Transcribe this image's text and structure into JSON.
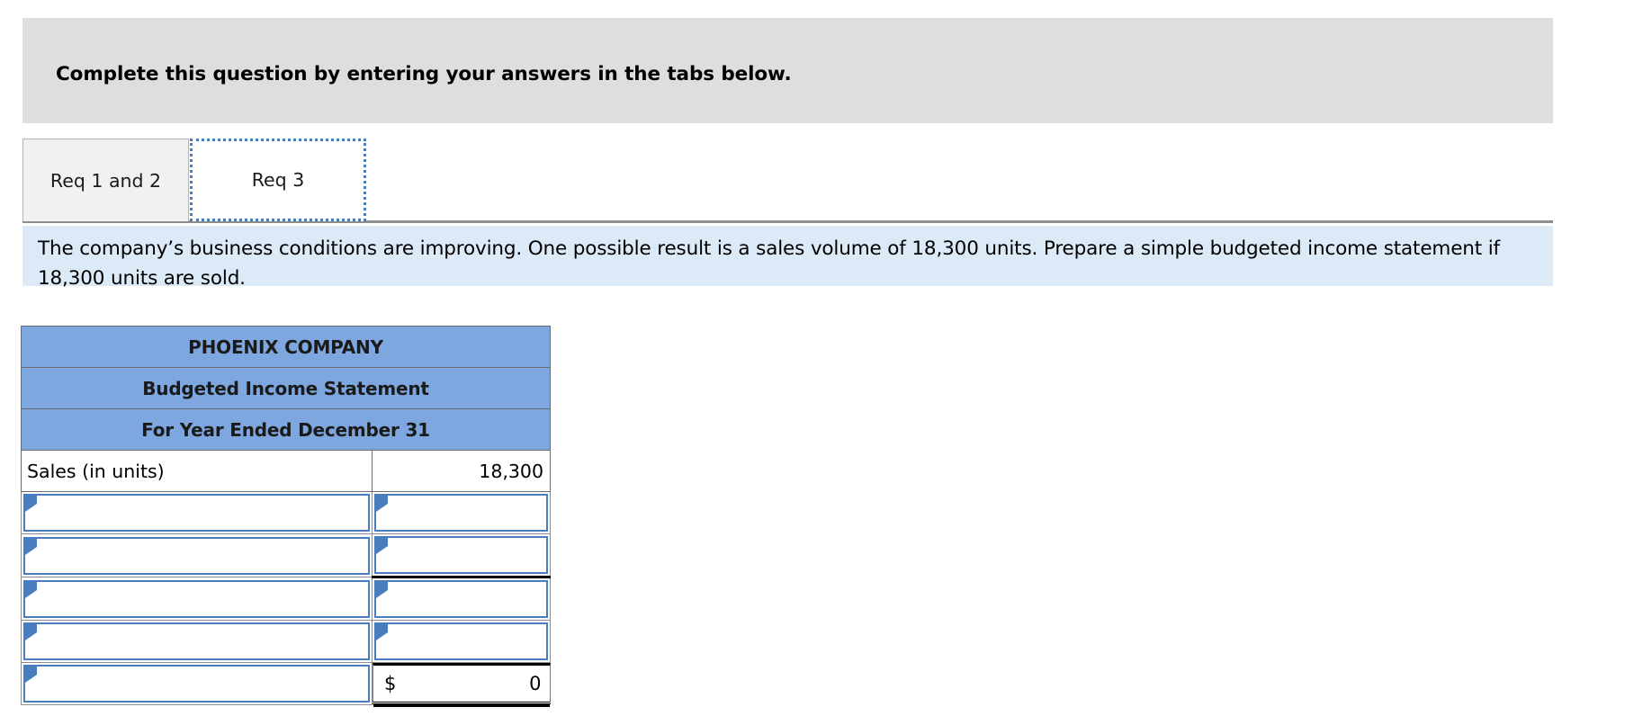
{
  "banner": {
    "text": "Complete this question by entering your answers in the tabs below."
  },
  "tabs": [
    {
      "label": "Req 1 and 2",
      "active": false
    },
    {
      "label": "Req 3",
      "active": true
    }
  ],
  "instruction": {
    "text": "The company’s business conditions are improving. One possible result is a sales volume of 18,300 units. Prepare a simple budgeted income statement if 18,300 units are sold."
  },
  "statement": {
    "title_lines": [
      "PHOENIX COMPANY",
      "Budgeted Income Statement",
      "For Year Ended December 31"
    ],
    "sales_row": {
      "label": "Sales (in units)",
      "value": "18,300"
    },
    "entry_rows": [
      {
        "label": "",
        "value": ""
      },
      {
        "label": "",
        "value": ""
      },
      {
        "label": "",
        "value": ""
      },
      {
        "label": "",
        "value": ""
      }
    ],
    "total_row": {
      "label": "",
      "currency_symbol": "$",
      "amount": "0"
    }
  },
  "colors": {
    "banner_bg": "#dedede",
    "instruction_bg": "#dce9f7",
    "table_header_bg": "#7da7de",
    "input_border": "#4a7dbd",
    "tab_active_border": "#4a7dbd",
    "tab_inactive_bg": "#f1f1f1"
  }
}
